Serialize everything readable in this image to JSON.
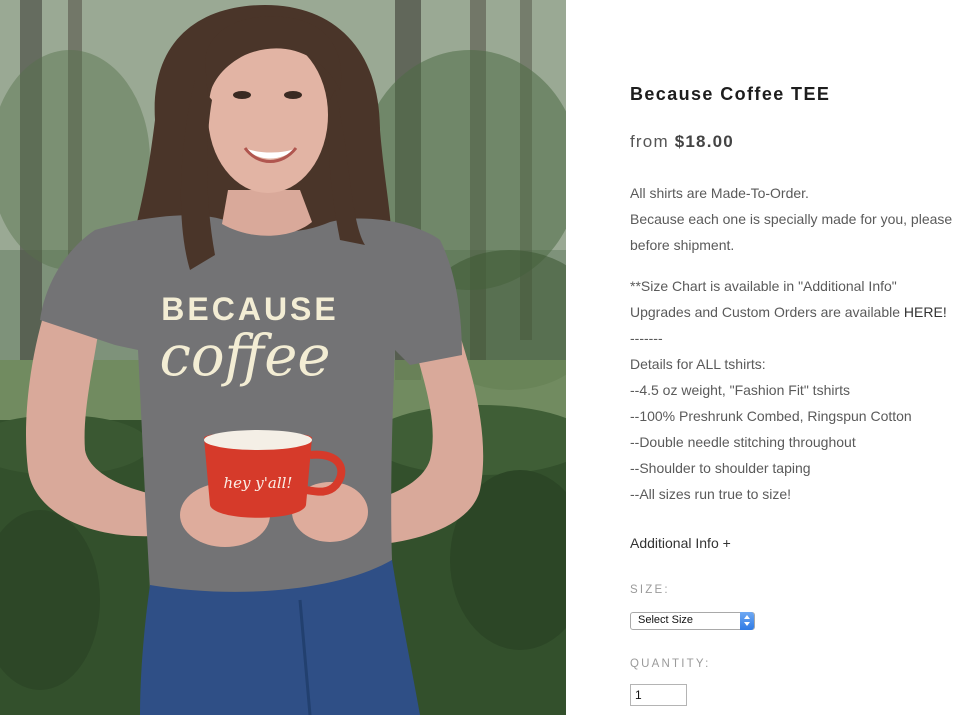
{
  "product": {
    "title": "Because Coffee TEE",
    "price_prefix": "from",
    "price": "$18.00",
    "shirt_print_line1": "BECAUSE",
    "shirt_print_line2": "coffee",
    "mug_print": "hey y'all!"
  },
  "description": {
    "lines_1": [
      "All shirts are Made-To-Order.",
      "Because each one is specially made for you, please",
      "before shipment."
    ],
    "size_chart_note": "**Size Chart is available in \"Additional Info\"",
    "upgrades_text": "Upgrades and Custom Orders are available ",
    "upgrades_link": "HERE!",
    "lines_2": [
      "-------",
      "Details for ALL tshirts:",
      "--4.5 oz weight, \"Fashion Fit\" tshirts",
      "--100% Preshrunk Combed, Ringspun Cotton",
      "--Double needle stitching throughout",
      "--Shoulder to shoulder taping",
      "--All sizes run true to size!"
    ]
  },
  "additional_info": "Additional Info +",
  "size": {
    "label": "SIZE:",
    "selected": "Select Size"
  },
  "quantity": {
    "label": "QUANTITY:",
    "value": "1"
  },
  "colors": {
    "shirt": "#737375",
    "mug": "#d63a2a",
    "jeans": "#2f4f86",
    "print": "#f3edd4"
  }
}
